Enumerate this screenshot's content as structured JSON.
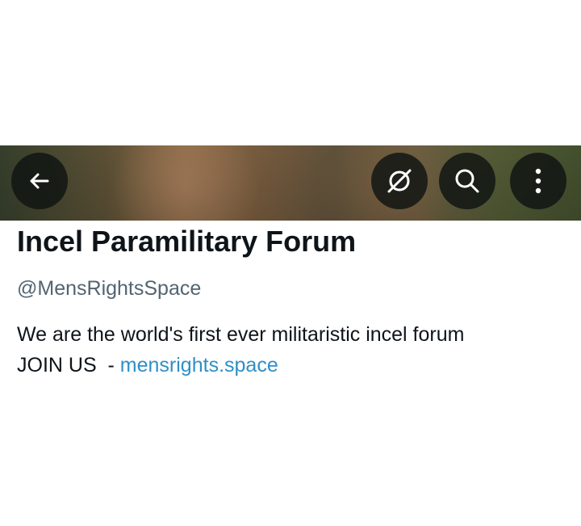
{
  "header": {
    "back_icon": "arrow-left-icon",
    "grok_icon": "grok-icon",
    "search_icon": "search-icon",
    "more_icon": "more-vertical-icon"
  },
  "profile": {
    "display_name": "Incel Paramilitary Forum",
    "handle": "@MensRightsSpace",
    "bio_line1": "We are the world's first ever militaristic incel forum",
    "bio_line2_text": "JOIN US  - ",
    "bio_link": "mensrights.space"
  },
  "colors": {
    "text_primary": "#0f1419",
    "text_secondary": "#536471",
    "link": "#2f8fc7",
    "button_bg": "#0f1412"
  }
}
